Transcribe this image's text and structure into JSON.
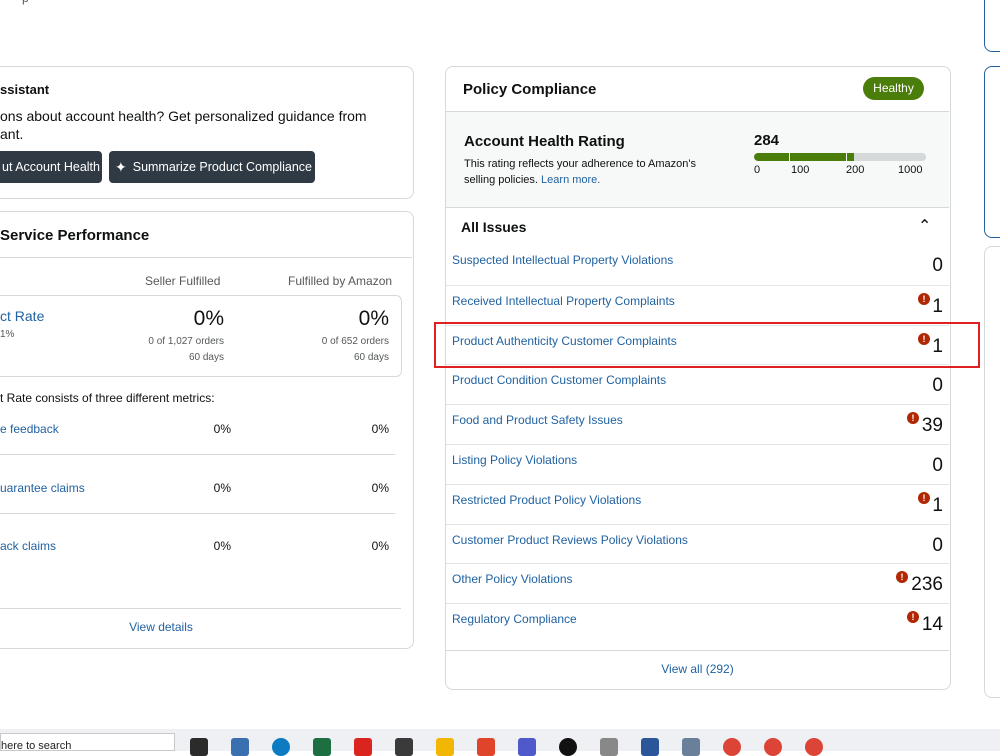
{
  "top_fragment": "p",
  "assistant": {
    "title": "ssistant",
    "line1": "ons about account health? Get personalized guidance from",
    "line2": "ant.",
    "btn_account_health": "ut Account Health",
    "btn_summarize": "Summarize Product Compliance"
  },
  "service": {
    "title": "Service Performance",
    "col_seller": "Seller Fulfilled",
    "col_fba": "Fulfilled by Amazon",
    "defect": {
      "label": "ct Rate",
      "target": "1%",
      "seller_value": "0%",
      "seller_orders": "0 of 1,027 orders",
      "seller_days": "60 days",
      "fba_value": "0%",
      "fba_orders": "0 of 652 orders",
      "fba_days": "60 days"
    },
    "metrics_intro": "t Rate consists of three different metrics:",
    "metrics": [
      {
        "label": "e feedback",
        "seller": "0%",
        "fba": "0%"
      },
      {
        "label": "uarantee claims",
        "seller": "0%",
        "fba": "0%"
      },
      {
        "label": "ack claims",
        "seller": "0%",
        "fba": "0%"
      }
    ],
    "view_details": "View details"
  },
  "policy": {
    "title": "Policy Compliance",
    "status_badge": "Healthy",
    "status_color": "#4a7d0a",
    "ahr_title": "Account Health Rating",
    "ahr_desc_1": "This rating reflects your adherence to Amazon's",
    "ahr_desc_2": "selling policies.",
    "learn_more": "Learn more.",
    "ahr_value": "284",
    "ahr_scale": [
      "0",
      "100",
      "200",
      "1000"
    ],
    "ahr_fill_fraction": 0.284,
    "all_issues": "All Issues",
    "issues": [
      {
        "label": "Suspected Intellectual Property Violations",
        "count": "0",
        "warn": false
      },
      {
        "label": "Received Intellectual Property Complaints",
        "count": "1",
        "warn": true
      },
      {
        "label": "Product Authenticity Customer Complaints",
        "count": "1",
        "warn": true,
        "highlighted": true
      },
      {
        "label": "Product Condition Customer Complaints",
        "count": "0",
        "warn": false
      },
      {
        "label": "Food and Product Safety Issues",
        "count": "39",
        "warn": true
      },
      {
        "label": "Listing Policy Violations",
        "count": "0",
        "warn": false
      },
      {
        "label": "Restricted Product Policy Violations",
        "count": "1",
        "warn": true
      },
      {
        "label": "Customer Product Reviews Policy Violations",
        "count": "0",
        "warn": false
      },
      {
        "label": "Other Policy Violations",
        "count": "236",
        "warn": true
      },
      {
        "label": "Regulatory Compliance",
        "count": "14",
        "warn": true
      }
    ],
    "view_all": "View all (292)"
  },
  "taskbar": {
    "search_text": "here to search",
    "icons": [
      "task-view-icon",
      "calculator-icon",
      "edge-icon",
      "excel-icon",
      "opera-icon",
      "media-icon",
      "file-explorer-icon",
      "git-icon",
      "teams-icon",
      "ui-icon",
      "app-icon",
      "word-icon",
      "storage-icon",
      "chrome-icon",
      "chrome-icon",
      "chrome-icon"
    ]
  }
}
